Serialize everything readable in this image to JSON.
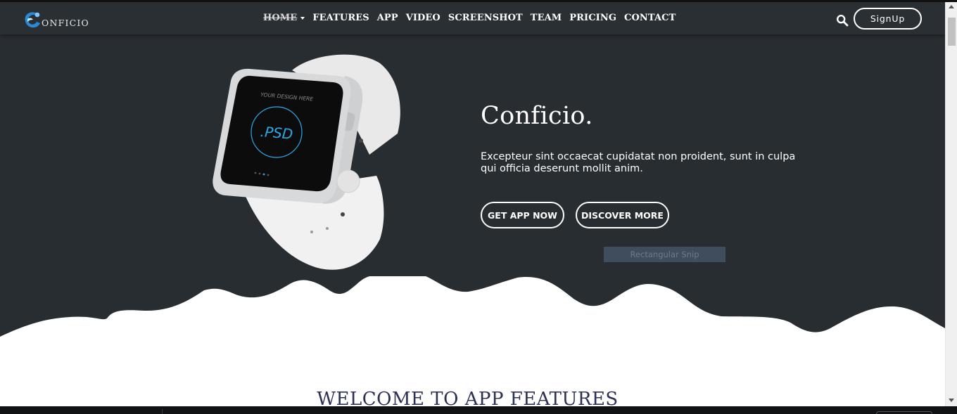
{
  "brand": {
    "name": "ONFICIO",
    "accent": "#2a8ad8",
    "nav_bg": "#2a2f33",
    "hero_bg": "#282d31"
  },
  "nav": {
    "items": [
      {
        "label": "HOME",
        "active": true,
        "has_dropdown": true
      },
      {
        "label": "FEATURES"
      },
      {
        "label": "APP"
      },
      {
        "label": "VIDEO"
      },
      {
        "label": "SCREENSHOT"
      },
      {
        "label": "TEAM"
      },
      {
        "label": "PRICING"
      },
      {
        "label": "CONTACT"
      }
    ],
    "search_icon": "search-icon",
    "signup_label": "SignUp"
  },
  "hero": {
    "title": "Conficio.",
    "description": "Excepteur sint occaecat cupidatat non proident, sunt in culpa qui officia deserunt mollit anim.",
    "buttons": {
      "get_app": "GET APP NOW",
      "discover": "DISCOVER MORE"
    },
    "watch": {
      "screen_caption": "YOUR DESIGN HERE",
      "screen_label": ".PSD"
    },
    "snip_label": "Rectangular Snip"
  },
  "section": {
    "welcome_title": "WELCOME TO APP FEATURES"
  }
}
